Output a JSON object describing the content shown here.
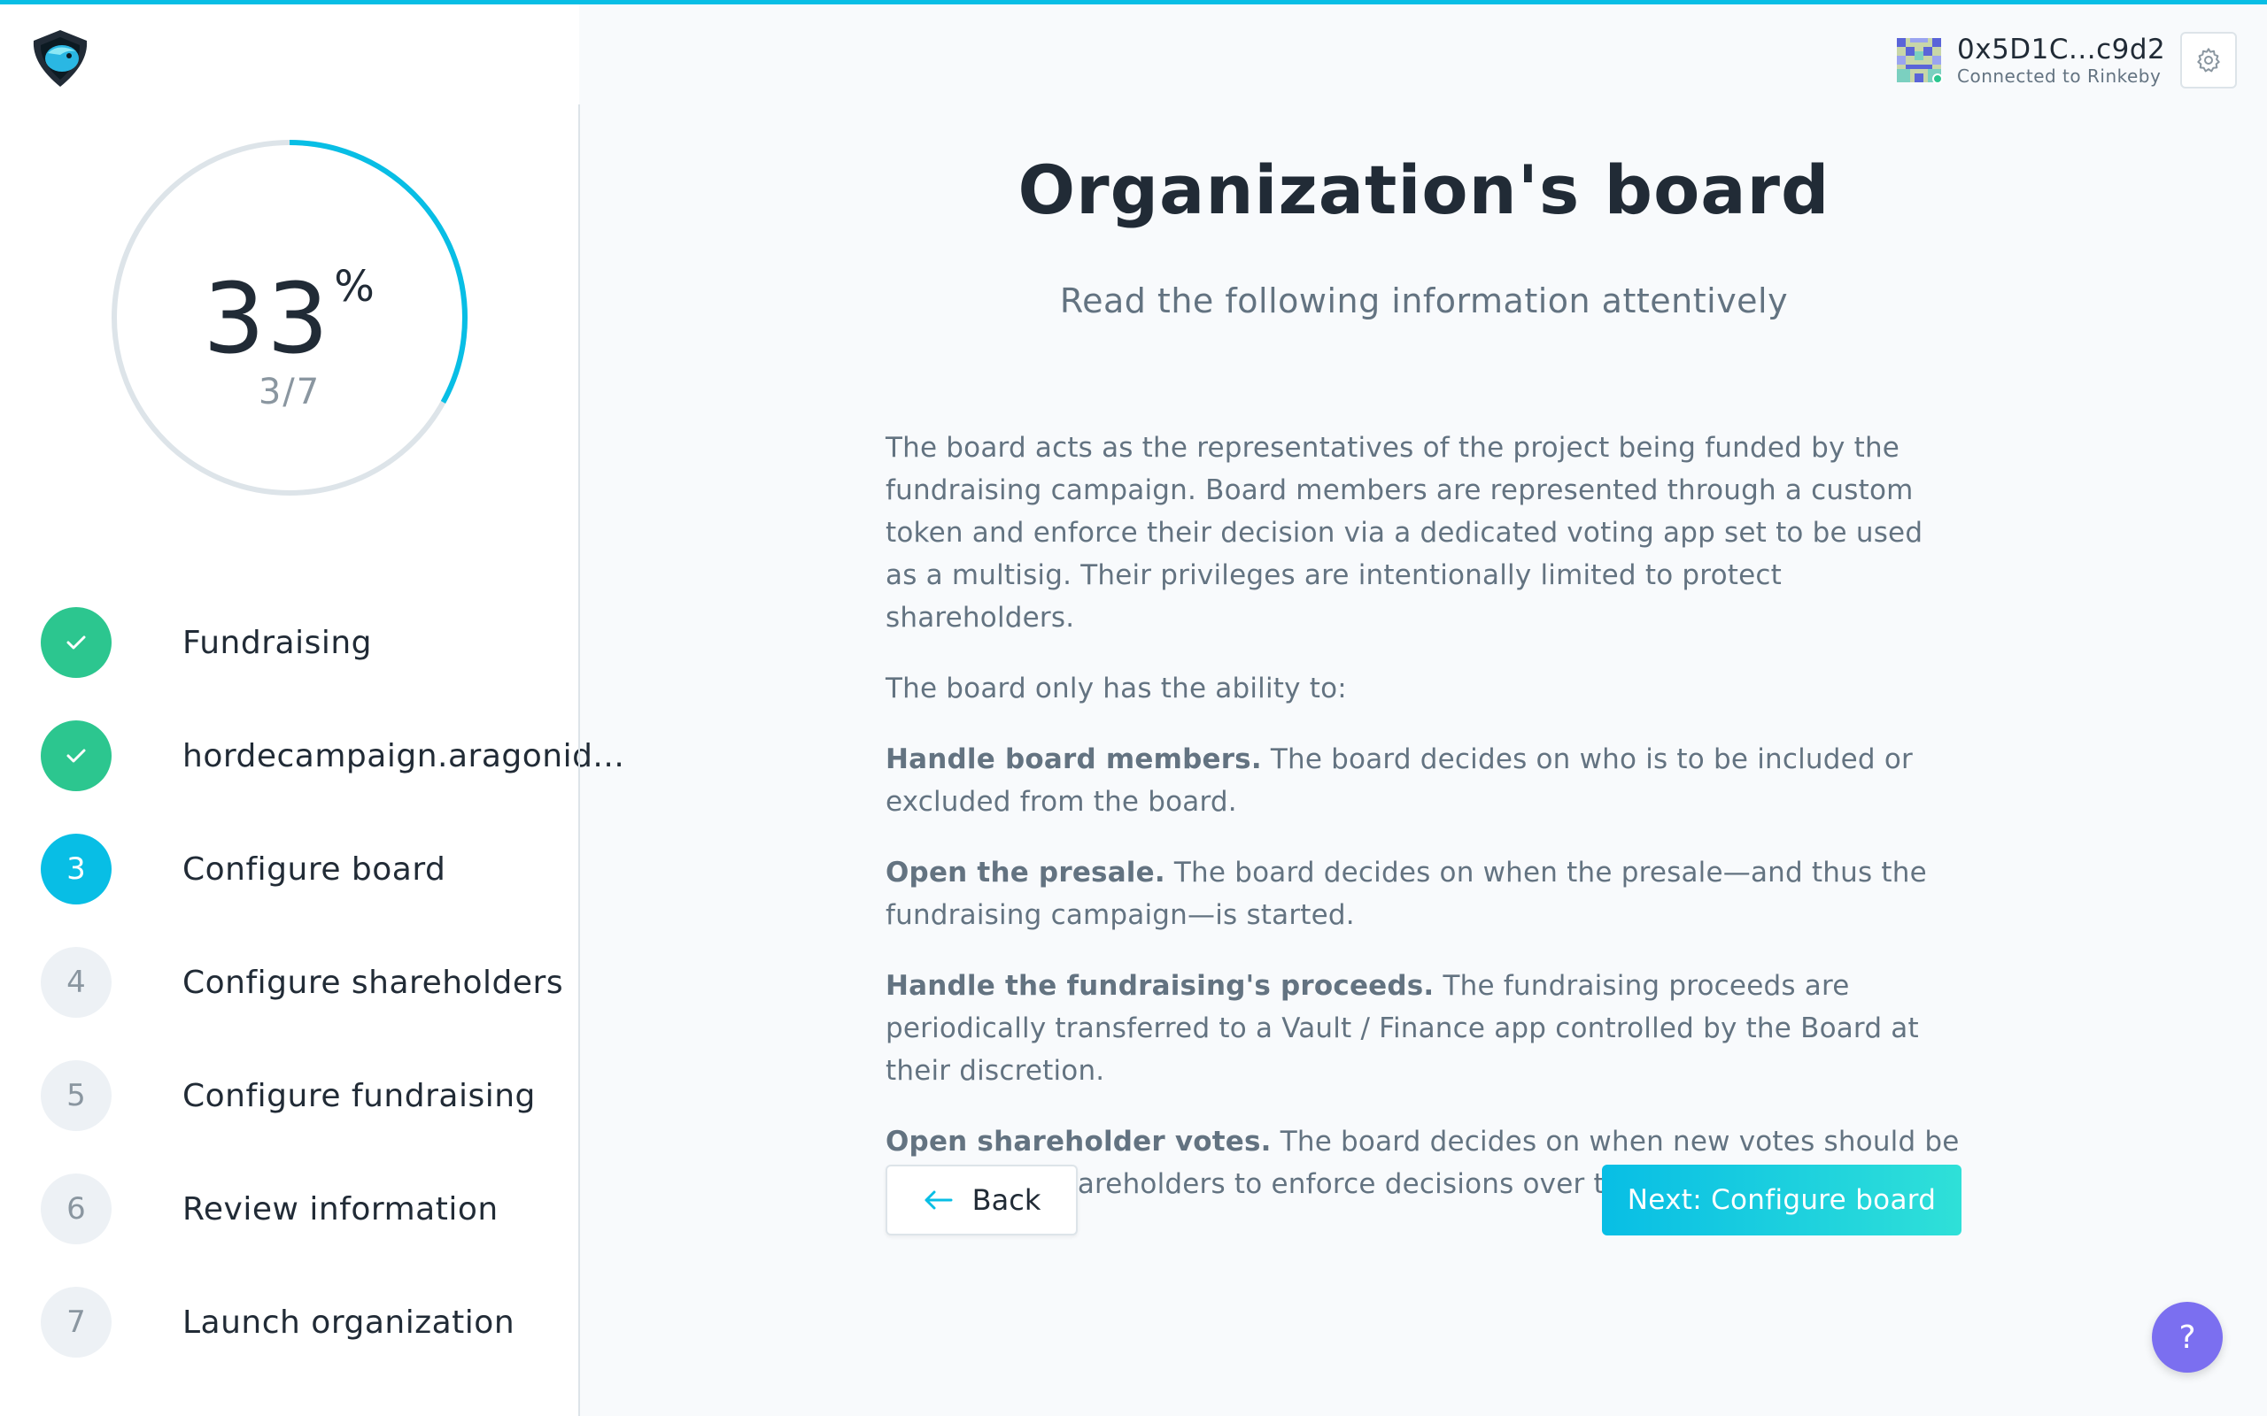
{
  "progress": {
    "percent": "33",
    "percent_sign": "%",
    "steps": "3/7",
    "fraction": 0.33
  },
  "sidebar": {
    "steps": [
      {
        "number": "1",
        "label": "Fundraising",
        "state": "done"
      },
      {
        "number": "2",
        "label": "hordecampaign.aragonid...",
        "state": "done"
      },
      {
        "number": "3",
        "label": "Configure board",
        "state": "active"
      },
      {
        "number": "4",
        "label": "Configure shareholders",
        "state": "todo"
      },
      {
        "number": "5",
        "label": "Configure fundraising",
        "state": "todo"
      },
      {
        "number": "6",
        "label": "Review information",
        "state": "todo"
      },
      {
        "number": "7",
        "label": "Launch organization",
        "state": "todo"
      }
    ]
  },
  "header": {
    "account_address": "0x5D1C...c9d2",
    "network_status": "Connected to Rinkeby"
  },
  "main": {
    "title": "Organization's board",
    "subtitle": "Read the following information attentively",
    "intro": "The board acts as the representatives of the project being funded by the fundraising campaign. Board members are represented through a custom token and enforce their decision via a dedicated voting app set to be used as a multisig. Their privileges are intentionally limited to protect shareholders.",
    "ability_intro": "The board only has the ability to:",
    "abilities": [
      {
        "title": "Handle board members.",
        "text": " The board decides on who is to be included or excluded from the board."
      },
      {
        "title": "Open the presale.",
        "text": " The board decides on when the presale—and thus the fundraising campaign—is started."
      },
      {
        "title": "Handle the fundraising's proceeds.",
        "text": " The fundraising proceeds are periodically transferred to a Vault / Finance app controlled by the Board at their discretion."
      },
      {
        "title": "Open shareholder votes.",
        "text": " The board decides on when new votes should be opened for shareholders to enforce decisions over the organization."
      }
    ],
    "back_label": "Back",
    "next_label": "Next: Configure board",
    "help_label": "?"
  },
  "colors": {
    "accent": "#08bee5",
    "success": "#2cc68f",
    "help": "#7b6ff0"
  },
  "icons": {
    "logo": "aragon-eagle-logo",
    "check": "check-icon",
    "back": "arrow-left-icon",
    "settings": "gear-icon"
  }
}
